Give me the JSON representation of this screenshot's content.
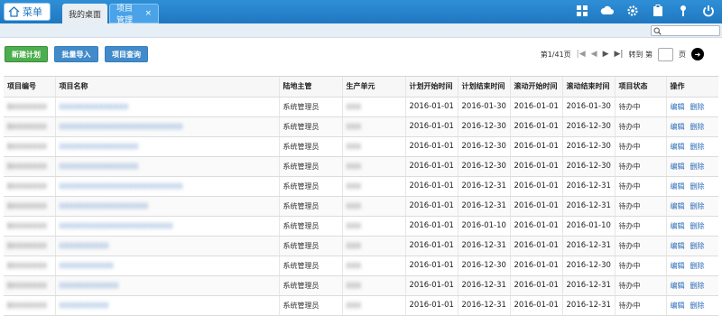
{
  "topbar": {
    "menu_label": "菜单",
    "tabs": [
      {
        "label": "我的桌面"
      },
      {
        "label": "项目管理",
        "close": "×"
      }
    ],
    "icons": [
      "grid-icon",
      "cloud-icon",
      "settings-icon",
      "clipboard-icon",
      "key-icon",
      "power-icon"
    ]
  },
  "toolbar": {
    "new_plan": "新建计划",
    "bulk_import": "批量导入",
    "project_query": "项目查询"
  },
  "pager": {
    "page_info": "第1/41页",
    "first": "|◀",
    "prev": "◀",
    "next": "▶",
    "last": "▶|",
    "goto_label": "转到 第",
    "page_unit": "页",
    "go": "➜"
  },
  "table": {
    "columns": [
      "项目编号",
      "项目名称",
      "陆地主管",
      "生产单元",
      "计划开始时间",
      "计划结束时间",
      "滚动开始时间",
      "滚动结束时间",
      "项目状态",
      "操作"
    ],
    "rows": [
      {
        "id": "BXXXXXXX",
        "name": "XXXXXXXXXXXXXX",
        "manager": "系统管理员",
        "unit": "XXX",
        "plan_start": "2016-01-01",
        "plan_end": "2016-01-30",
        "roll_start": "2016-01-01",
        "roll_end": "2016-01-30",
        "status": "待办中",
        "edit": "编辑",
        "delete": "删除"
      },
      {
        "id": "BXXXXXXX",
        "name": "XXXXXXXXXXXXXXXXXXXXXXXXX",
        "manager": "系统管理员",
        "unit": "XXX",
        "plan_start": "2016-01-01",
        "plan_end": "2016-12-30",
        "roll_start": "2016-01-01",
        "roll_end": "2016-12-30",
        "status": "待办中",
        "edit": "编辑",
        "delete": "删除"
      },
      {
        "id": "BXXXXXXX",
        "name": "XXXXXXXXXXXXXXXX",
        "manager": "系统管理员",
        "unit": "XXX",
        "plan_start": "2016-01-01",
        "plan_end": "2016-12-30",
        "roll_start": "2016-01-01",
        "roll_end": "2016-12-30",
        "status": "待办中",
        "edit": "编辑",
        "delete": "删除"
      },
      {
        "id": "BXXXXXXX",
        "name": "XXXXXXXXXXXXXXXX",
        "manager": "系统管理员",
        "unit": "XXX",
        "plan_start": "2016-01-01",
        "plan_end": "2016-12-30",
        "roll_start": "2016-01-01",
        "roll_end": "2016-12-30",
        "status": "待办中",
        "edit": "编辑",
        "delete": "删除"
      },
      {
        "id": "BXXXXXXX",
        "name": "XXXXXXXXXXXXXXXXXXXXXXXXX",
        "manager": "系统管理员",
        "unit": "XXX",
        "plan_start": "2016-01-01",
        "plan_end": "2016-12-31",
        "roll_start": "2016-01-01",
        "roll_end": "2016-12-31",
        "status": "待办中",
        "edit": "编辑",
        "delete": "删除"
      },
      {
        "id": "BXXXXXXX",
        "name": "XXXXXXXXXXXXXXXXXX",
        "manager": "系统管理员",
        "unit": "XXX",
        "plan_start": "2016-01-01",
        "plan_end": "2016-12-31",
        "roll_start": "2016-01-01",
        "roll_end": "2016-12-31",
        "status": "待办中",
        "edit": "编辑",
        "delete": "删除"
      },
      {
        "id": "BXXXXXXX",
        "name": "XXXXXXXXXXXXXXXXXXXXXXX",
        "manager": "系统管理员",
        "unit": "XXX",
        "plan_start": "2016-01-01",
        "plan_end": "2016-01-10",
        "roll_start": "2016-01-01",
        "roll_end": "2016-01-10",
        "status": "待办中",
        "edit": "编辑",
        "delete": "删除"
      },
      {
        "id": "BXXXXXXX",
        "name": "XXXXXXXXXX",
        "manager": "系统管理员",
        "unit": "XXX",
        "plan_start": "2016-01-01",
        "plan_end": "2016-12-31",
        "roll_start": "2016-01-01",
        "roll_end": "2016-12-31",
        "status": "待办中",
        "edit": "编辑",
        "delete": "删除"
      },
      {
        "id": "BXXXXXXX",
        "name": "XXXXXXXXXXX",
        "manager": "系统管理员",
        "unit": "XXX",
        "plan_start": "2016-01-01",
        "plan_end": "2016-12-30",
        "roll_start": "2016-01-01",
        "roll_end": "2016-12-30",
        "status": "待办中",
        "edit": "编辑",
        "delete": "删除"
      },
      {
        "id": "BXXXXXXX",
        "name": "XXXXXXXXXXXX",
        "manager": "系统管理员",
        "unit": "XXX",
        "plan_start": "2016-01-01",
        "plan_end": "2016-12-31",
        "roll_start": "2016-01-01",
        "roll_end": "2016-12-31",
        "status": "待办中",
        "edit": "编辑",
        "delete": "删除"
      },
      {
        "id": "BXXXXXXX",
        "name": "XXXXXXXXXX",
        "manager": "系统管理员",
        "unit": "XXX",
        "plan_start": "2016-01-01",
        "plan_end": "2016-12-31",
        "roll_start": "2016-01-01",
        "roll_end": "2016-12-31",
        "status": "待办中",
        "edit": "编辑",
        "delete": "删除"
      }
    ]
  }
}
